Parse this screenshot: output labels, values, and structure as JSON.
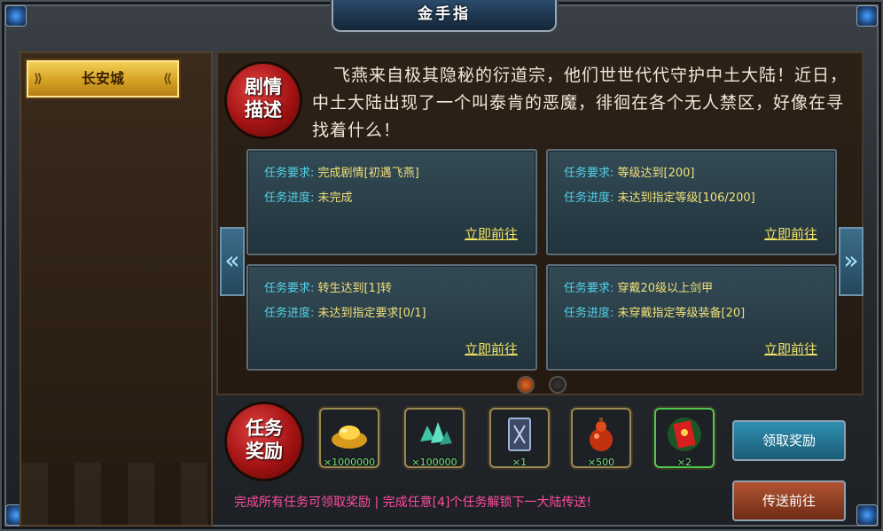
{
  "window": {
    "title": "金手指"
  },
  "sidebar": {
    "items": [
      {
        "label": "长安城"
      }
    ]
  },
  "story": {
    "badge_line1": "剧情",
    "badge_line2": "描述",
    "text": "飞燕来自极其隐秘的衍道宗，他们世世代代守护中土大陆！近日，中土大陆出现了一个叫泰肯的恶魔，徘徊在各个无人禁区，好像在寻找着什么！"
  },
  "tasks": [
    {
      "req_label": "任务要求:",
      "req_value": "完成剧情[初遇飞燕]",
      "prog_label": "任务进度:",
      "prog_value": "未完成",
      "go_label": "立即前往"
    },
    {
      "req_label": "任务要求:",
      "req_value": "等级达到[200]",
      "prog_label": "任务进度:",
      "prog_value": "未达到指定等级[106/200]",
      "go_label": "立即前往"
    },
    {
      "req_label": "任务要求:",
      "req_value": "转生达到[1]转",
      "prog_label": "任务进度:",
      "prog_value": "未达到指定要求[0/1]",
      "go_label": "立即前往"
    },
    {
      "req_label": "任务要求:",
      "req_value": "穿戴20级以上剑甲",
      "prog_label": "任务进度:",
      "prog_value": "未穿戴指定等级装备[20]",
      "go_label": "立即前往"
    }
  ],
  "pagination": {
    "current": 1,
    "total": 2
  },
  "rewards": {
    "badge_line1": "任务",
    "badge_line2": "奖励",
    "items": [
      {
        "icon": "gold-ingot-icon",
        "qty": "×1000000"
      },
      {
        "icon": "crystal-ore-icon",
        "qty": "×100000"
      },
      {
        "icon": "scroll-card-icon",
        "qty": "×1"
      },
      {
        "icon": "red-gourd-icon",
        "qty": "×500"
      },
      {
        "icon": "red-envelope-icon",
        "qty": "×2"
      }
    ]
  },
  "buttons": {
    "claim": "领取奖励",
    "teleport": "传送前往"
  },
  "footer": {
    "tip": "完成所有任务可领取奖励 | 完成任意[4]个任务解锁下一大陆传送!"
  },
  "colors": {
    "accent_cyan": "#52d2e8",
    "value_yellow": "#f1e07a",
    "footer_pink": "#ff4da0",
    "qty_green": "#74e27a"
  }
}
